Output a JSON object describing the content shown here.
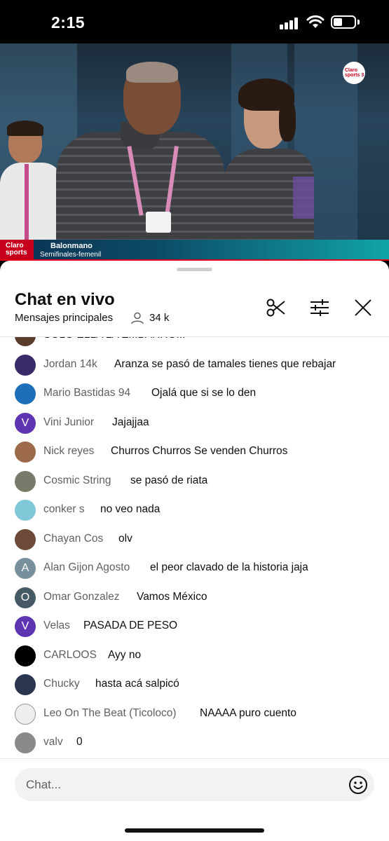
{
  "status_bar": {
    "time": "2:15"
  },
  "video": {
    "channel_logo": "Claro sports 3",
    "lower_third": {
      "brand": "Claro sports",
      "title": "Balonmano",
      "subtitle": "Semifinales-femenil"
    }
  },
  "chat": {
    "title": "Chat en vivo",
    "mode": "Mensajes principales",
    "viewer_count": "34 k",
    "header_icons": [
      "scissors-icon",
      "filter-icon",
      "close-icon"
    ],
    "messages": [
      {
        "author": "",
        "text": "SOLO ELLA LA EMBARRO...",
        "avatar": "",
        "avatar_color": "#5a3a2a"
      },
      {
        "author": "Jordan 14k",
        "text": "Aranza se pasó de tamales tienes que rebajar",
        "avatar": "",
        "avatar_color": "#3a2a6a"
      },
      {
        "author": "Mario Bastidas 94",
        "text": "Ojalá que si se lo den",
        "avatar": "",
        "avatar_color": "#1d6fb8"
      },
      {
        "author": "Vini Junior",
        "text": "Jajajjaa",
        "avatar": "V",
        "avatar_color": "#5e35b1"
      },
      {
        "author": "Nick reyes",
        "text": "Churros Churros Se venden Churros",
        "avatar": "",
        "avatar_color": "#9c6a4a"
      },
      {
        "author": "Cosmic String",
        "text": "se pasó de riata",
        "avatar": "",
        "avatar_color": "#7a7a6a"
      },
      {
        "author": "conker s",
        "text": "no veo nada",
        "avatar": "",
        "avatar_color": "#7fc6d6"
      },
      {
        "author": "Chayan Cos",
        "text": "olv",
        "avatar": "",
        "avatar_color": "#6b4a3a"
      },
      {
        "author": "Alan Gijon Agosto",
        "text": "el peor clavado de la historia jaja",
        "avatar": "A",
        "avatar_color": "#78909c"
      },
      {
        "author": "Omar Gonzalez",
        "text": "Vamos México",
        "avatar": "O",
        "avatar_color": "#455a64"
      },
      {
        "author": "Velas",
        "text": "PASADA DE PESO",
        "avatar": "V",
        "avatar_color": "#5e35b1"
      },
      {
        "author": "CARLOOS",
        "text": "Ayy no",
        "avatar": "",
        "avatar_color": "#000000"
      },
      {
        "author": "Chucky",
        "text": "hasta acá salpicó",
        "avatar": "",
        "avatar_color": "#2a3550"
      },
      {
        "author": "Leo On The Beat (Ticoloco)",
        "text": "NAAAA puro cuento",
        "avatar": "",
        "avatar_color": "#eeeeee"
      },
      {
        "author": "valv",
        "text": "0",
        "avatar": "",
        "avatar_color": "#8a8a8a"
      }
    ],
    "input": {
      "placeholder": "Chat..."
    }
  }
}
